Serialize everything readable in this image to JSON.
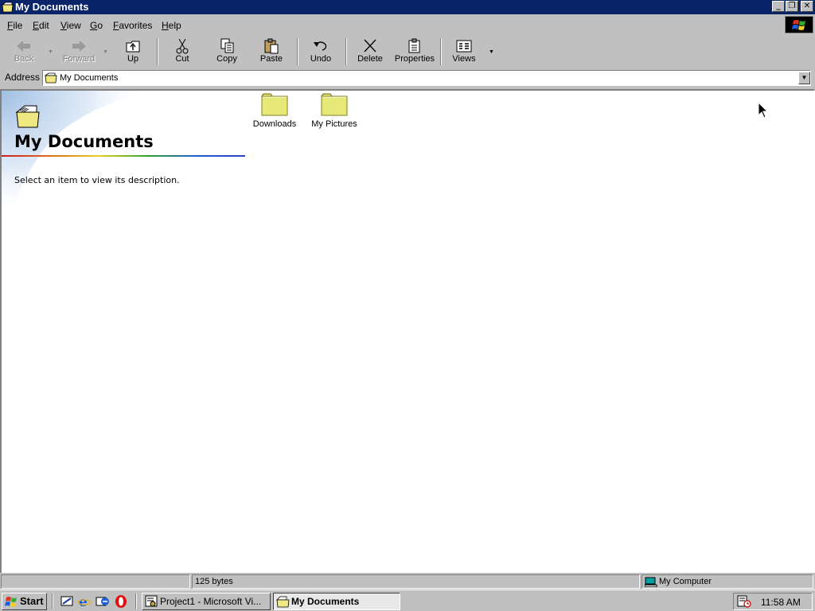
{
  "window": {
    "title": "My Documents",
    "controls": [
      "minimize-icon",
      "restore-icon",
      "close-icon"
    ]
  },
  "menu": {
    "items": [
      {
        "label": "File"
      },
      {
        "label": "Edit"
      },
      {
        "label": "View"
      },
      {
        "label": "Go"
      },
      {
        "label": "Favorites"
      },
      {
        "label": "Help"
      }
    ]
  },
  "toolbar": {
    "back": "Back",
    "forward": "Forward",
    "up": "Up",
    "cut": "Cut",
    "copy": "Copy",
    "paste": "Paste",
    "undo": "Undo",
    "delete": "Delete",
    "properties": "Properties",
    "views": "Views"
  },
  "address": {
    "label": "Address",
    "value": "My Documents"
  },
  "webinfo": {
    "title": "My Documents",
    "description": "Select an item to view its description."
  },
  "files": [
    {
      "name": "Downloads",
      "icon": "folder-icon"
    },
    {
      "name": "My Pictures",
      "icon": "folder-icon"
    }
  ],
  "status": {
    "left": "",
    "size": "125 bytes",
    "zone": "My Computer"
  },
  "taskbar": {
    "start": "Start",
    "quicklaunch": [
      "show-desktop-icon",
      "internet-explorer-icon",
      "outlook-express-icon",
      "opera-icon"
    ],
    "tasks": [
      {
        "label": "Project1 - Microsoft Vi...",
        "active": false
      },
      {
        "label": "My Documents",
        "active": true
      }
    ],
    "clock": "11:58 AM"
  },
  "colors": {
    "titlebar": "#0a246a",
    "face": "#c0c0c0",
    "folder": "#e6e878"
  }
}
